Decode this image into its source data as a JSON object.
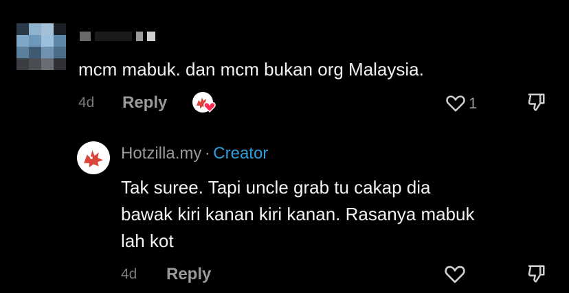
{
  "comment": {
    "text": "mcm mabuk. dan mcm bukan org Malaysia.",
    "time": "4d",
    "reply_label": "Reply",
    "like_count": "1"
  },
  "reply": {
    "username": "Hotzilla.my",
    "separator": "·",
    "badge": "Creator",
    "text_lines": [
      "Tak suree. Tapi uncle grab tu cakap dia",
      "bawak kiri kanan kiri kanan. Rasanya mabuk",
      "lah kot"
    ],
    "time": "4d",
    "reply_label": "Reply"
  },
  "colors": {
    "background": "#000000",
    "creator_badge": "#2e9fd9",
    "heart_badge": "#fe2c55",
    "mascot": "#d9463a"
  },
  "icons": [
    "heart-outline-icon",
    "thumbs-down-icon",
    "creator-liked-badge-icon",
    "mascot-avatar-icon"
  ]
}
